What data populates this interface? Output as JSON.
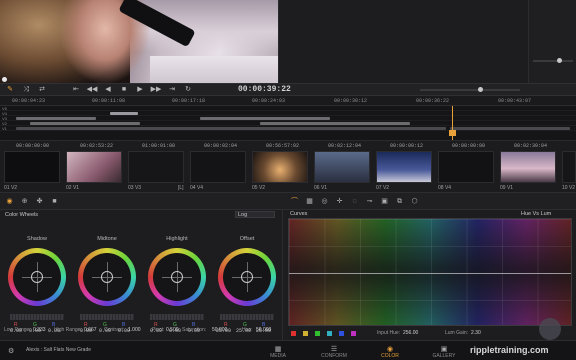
{
  "viewer": {
    "timecode": "00:00:39:22"
  },
  "transport": {
    "buttons": [
      "⇤",
      "◀◀",
      "◀",
      "■",
      "▶",
      "▶▶",
      "⇥",
      "↻"
    ]
  },
  "ruler": {
    "timecodes": [
      "00:00:04:23",
      "00:00:11:08",
      "00:00:17:18",
      "00:00:24:03",
      "00:00:30:12",
      "00:00:36:22",
      "00:00:43:07"
    ]
  },
  "tracks": {
    "labels": [
      "V5",
      "V4",
      "V3",
      "V2",
      "V1"
    ]
  },
  "thumbnails": [
    {
      "tc": "00:00:00:00",
      "name": "01 V2",
      "color": "#0e0e10"
    },
    {
      "tc": "00:02:53:22",
      "name": "02 V1",
      "color": "#a7708a"
    },
    {
      "tc": "01:00:01:08",
      "name": "03 V3",
      "color": "#161618"
    },
    {
      "tc": "00:00:02:04",
      "name": "04 V4",
      "color": "#141416",
      "badge": "[L]"
    },
    {
      "tc": "00:56:57:02",
      "name": "05 V2",
      "color": "#6a5a4a"
    },
    {
      "tc": "00:02:12:04",
      "name": "06 V1",
      "color": "#3a4560"
    },
    {
      "tc": "00:00:00:12",
      "name": "07 V2",
      "color": "#2a3c6a"
    },
    {
      "tc": "00:00:00:00",
      "name": "08 V4",
      "color": "#121214"
    },
    {
      "tc": "00:02:30:04",
      "name": "09 V1",
      "color": "#a68a9e"
    },
    {
      "tc": "",
      "name": "10 V2",
      "color": "#161618"
    }
  ],
  "colorwheels": {
    "title": "Color Wheels",
    "mode": "Log",
    "wheels": [
      {
        "name": "Shadow",
        "values": [
          "0.00",
          "0.00",
          "0.00"
        ]
      },
      {
        "name": "Midtone",
        "values": [
          "0.00",
          "0.00",
          "0.00"
        ]
      },
      {
        "name": "Highlight",
        "values": [
          "0.00",
          "0.00",
          "0.00"
        ]
      },
      {
        "name": "Offset",
        "values": [
          "25.00",
          "25.00",
          "25.00"
        ]
      }
    ],
    "params": {
      "low_range_label": "Low Range:",
      "low_range": "0.333",
      "high_range_label": "High Range:",
      "high_range": "0.667",
      "contrast_label": "Contrast:",
      "contrast": "1.000",
      "pivot_label": "Pivot:",
      "pivot": "0.500",
      "saturation_label": "Saturation:",
      "saturation": "50.000",
      "hue_label": "Hue:",
      "hue": "50.000"
    }
  },
  "curves": {
    "title": "Curves",
    "mode": "Hue Vs Lum",
    "input_hue_label": "Input Hue:",
    "input_hue": "256.00",
    "lum_gain_label": "Lum Gain:",
    "lum_gain": "2.30",
    "swatches": [
      "#e03030",
      "#d0b030",
      "#30c030",
      "#30b0c0",
      "#3050e0",
      "#c030c0"
    ]
  },
  "statusbar": {
    "project": "Alexis : Salt Flats New Grade",
    "pages": [
      "MEDIA",
      "CONFORM",
      "COLOR",
      "GALLERY"
    ],
    "active_page": "COLOR",
    "watermark": "rippletraining.com"
  },
  "colors": {
    "accent": "#e8a03a",
    "bg": "#1b1b1d"
  }
}
